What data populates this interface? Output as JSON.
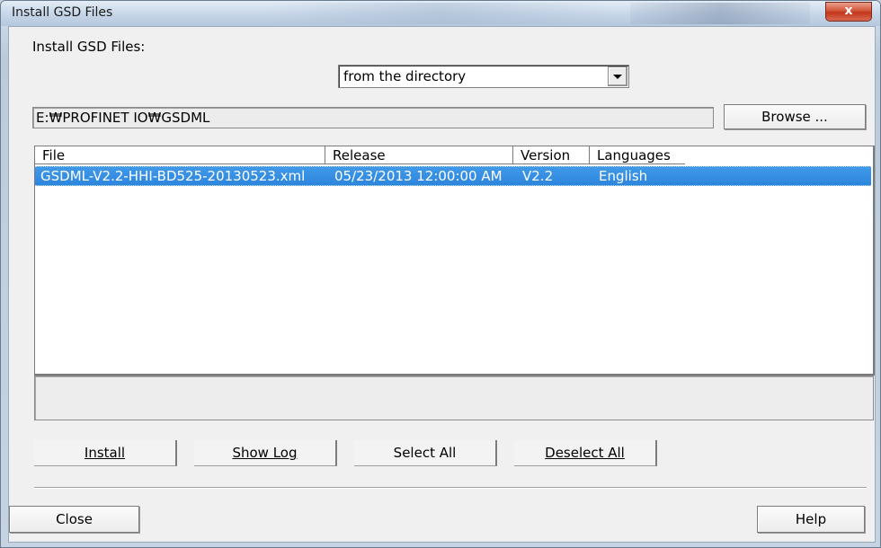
{
  "window": {
    "title": "Install GSD Files",
    "close_symbol": "x"
  },
  "form": {
    "source_label": "Install GSD Files:",
    "source_value": "from the directory",
    "path_value": "E:₩PROFINET IO₩GSDML",
    "browse_label": "Browse ..."
  },
  "table": {
    "columns": [
      "File",
      "Release",
      "Version",
      "Languages"
    ],
    "rows": [
      {
        "file": "GSDML-V2.2-HHI-BD525-20130523.xml",
        "release": "05/23/2013 12:00:00 AM",
        "version": "V2.2",
        "languages": "English",
        "selected": true
      }
    ]
  },
  "actions": {
    "install": "Install",
    "show_log": "Show Log",
    "select_all": "Select All",
    "deselect_all": "Deselect All"
  },
  "footer": {
    "close": "Close",
    "help": "Help"
  },
  "colors": {
    "selection": "#3390e3",
    "dialog_bg": "#f0f0f0",
    "close_button": "#c9482d"
  }
}
